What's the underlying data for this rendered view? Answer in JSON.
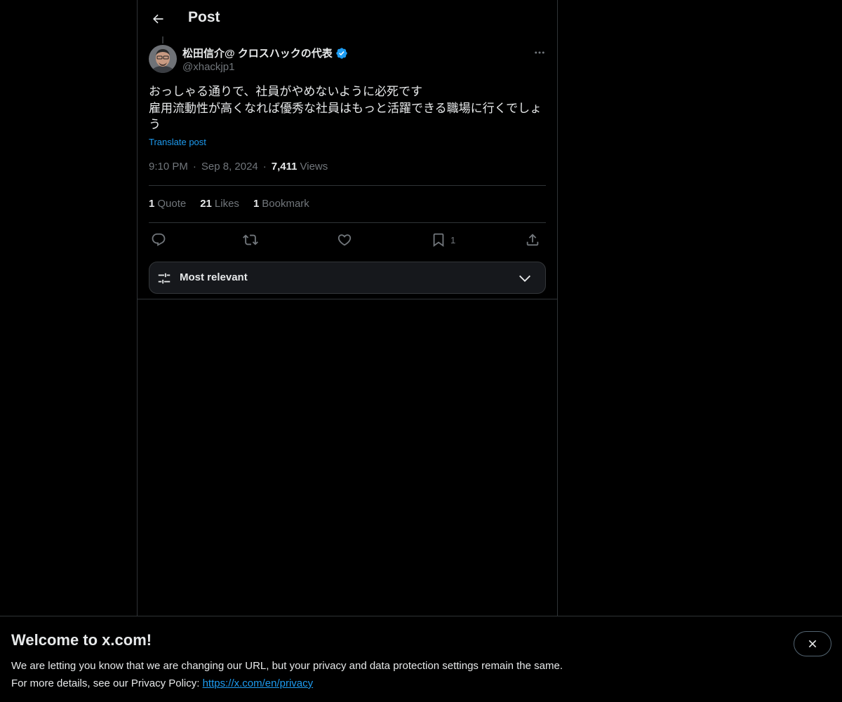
{
  "header": {
    "title": "Post"
  },
  "post": {
    "author_name": "松田信介@ クロスハックの代表",
    "author_handle": "@xhackjp1",
    "text_lines": [
      "おっしゃる通りで、社員がやめないように必死です",
      "雇用流動性が高くなれば優秀な社員はもっと活躍できる職場に行くでしょ",
      "う"
    ],
    "translate_label": "Translate post",
    "time": "9:10 PM",
    "date": "Sep 8, 2024",
    "views_count": "7,411",
    "views_label": "Views"
  },
  "stats": {
    "quotes_count": "1",
    "quotes_label": "Quote",
    "likes_count": "21",
    "likes_label": "Likes",
    "bookmarks_count": "1",
    "bookmarks_label": "Bookmark"
  },
  "actions": {
    "bookmark_count": "1"
  },
  "sort": {
    "label": "Most relevant"
  },
  "banner": {
    "title": "Welcome to x.com!",
    "line1": "We are letting you know that we are changing our URL, but your privacy and data protection settings remain the same.",
    "line2_prefix": "For more details, see our Privacy Policy: ",
    "link_text": "https://x.com/en/privacy"
  },
  "icons": {
    "back": "arrow-left-icon",
    "more": "more-horizontal-icon",
    "verified": "verified-badge-icon",
    "reply": "reply-icon",
    "repost": "repost-icon",
    "like": "heart-icon",
    "bookmark": "bookmark-icon",
    "share": "share-icon",
    "sort": "sliders-icon",
    "chevron": "chevron-down-icon",
    "close": "close-icon"
  },
  "colors": {
    "accent": "#1d9bf0",
    "background": "#000000",
    "text": "#e7e9ea",
    "muted": "#71767b",
    "border": "#2f3336"
  }
}
